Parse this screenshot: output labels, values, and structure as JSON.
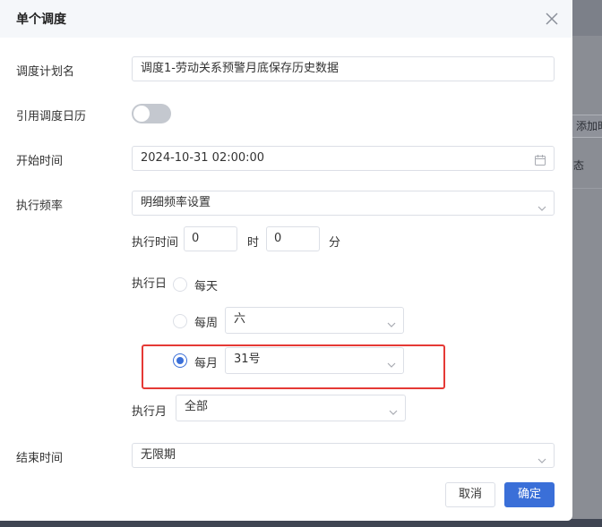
{
  "background": {
    "add_button_label": "添加时",
    "state_text": "态"
  },
  "dialog": {
    "title": "单个调度"
  },
  "form": {
    "schedule_name_label": "调度计划名",
    "schedule_name_value": "调度1-劳动关系预警月底保存历史数据",
    "use_calendar_label": "引用调度日历",
    "use_calendar_on": false,
    "start_time_label": "开始时间",
    "start_time_value": "2024-10-31 02:00:00",
    "frequency_label": "执行频率",
    "frequency_value": "明细频率设置",
    "exec_time_label": "执行时间",
    "exec_hour_value": "0",
    "hour_unit": "时",
    "exec_minute_value": "0",
    "minute_unit": "分",
    "exec_day_label": "执行日",
    "day_options": {
      "daily_label": "每天",
      "weekly_label": "每周",
      "weekly_value": "六",
      "monthly_label": "每月",
      "monthly_value": "31号",
      "selected": "monthly"
    },
    "exec_month_label": "执行月",
    "exec_month_value": "全部",
    "end_time_label": "结束时间",
    "end_time_value": "无限期"
  },
  "footer": {
    "cancel_label": "取消",
    "ok_label": "确定"
  },
  "colors": {
    "primary": "#3a6fd8",
    "highlight": "#e53935",
    "border": "#dcdfe6"
  }
}
